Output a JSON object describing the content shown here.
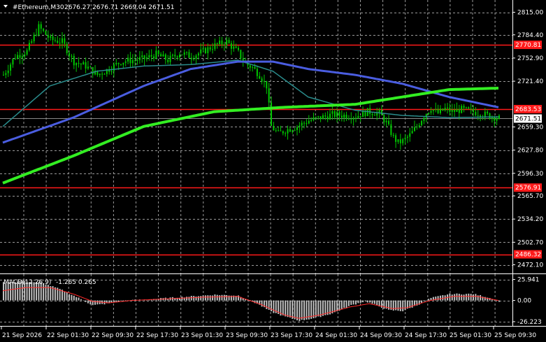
{
  "header": {
    "symbol_label": "#Ethereum,M30",
    "ohlc": "2676.27 2676.71 2669.04 2671.51"
  },
  "indicator_header": {
    "label": "MACD(12,26,9)",
    "values": "-1.265 0.265"
  },
  "colors": {
    "background": "#000000",
    "grid": "#9a9a9a",
    "candle": "#00c800",
    "ma_fast": "#2a8c8c",
    "ma_mid": "#4a5de0",
    "ma_slow": "#33ee22",
    "level_line": "#ff1a1a",
    "histogram": "#c0c0c0",
    "signal": "#ff2a2a"
  },
  "chart_data": [
    {
      "type": "candlestick",
      "title": "#Ethereum,M30",
      "price_ticks": [
        "2815.00",
        "2784.40",
        "2752.90",
        "2721.40",
        "2659.30",
        "2627.80",
        "2596.30",
        "2565.70",
        "2534.20",
        "2502.70",
        "2472.10"
      ],
      "ylim": [
        2466.0,
        2826.0
      ],
      "x_tick_labels": [
        "21 Sep 2026",
        "22 Sep 01:30",
        "22 Sep 09:30",
        "22 Sep 17:30",
        "23 Sep 01:30",
        "23 Sep 09:30",
        "23 Sep 17:30",
        "24 Sep 01:30",
        "24 Sep 09:30",
        "24 Sep 17:30",
        "25 Sep 01:30",
        "25 Sep 09:30"
      ],
      "current_price": {
        "label": "2671.51",
        "value": 2671.51
      },
      "levels": [
        {
          "label": "2770.81",
          "value": 2770.81
        },
        {
          "label": "2683.53",
          "value": 2683.53
        },
        {
          "label": "2576.91",
          "value": 2576.91
        },
        {
          "label": "2486.32",
          "value": 2486.32
        }
      ],
      "price_anchors": [
        [
          0,
          2730
        ],
        [
          5,
          2755
        ],
        [
          10,
          2762
        ],
        [
          15,
          2795
        ],
        [
          20,
          2778
        ],
        [
          25,
          2775
        ],
        [
          30,
          2748
        ],
        [
          35,
          2742
        ],
        [
          40,
          2730
        ],
        [
          45,
          2738
        ],
        [
          50,
          2748
        ],
        [
          55,
          2750
        ],
        [
          60,
          2752
        ],
        [
          65,
          2758
        ],
        [
          70,
          2750
        ],
        [
          75,
          2760
        ],
        [
          80,
          2755
        ],
        [
          85,
          2762
        ],
        [
          90,
          2770
        ],
        [
          95,
          2775
        ],
        [
          100,
          2760
        ],
        [
          103,
          2745
        ],
        [
          106,
          2740
        ],
        [
          109,
          2730
        ],
        [
          112,
          2715
        ],
        [
          114,
          2660
        ],
        [
          117,
          2650
        ],
        [
          120,
          2655
        ],
        [
          125,
          2660
        ],
        [
          130,
          2668
        ],
        [
          135,
          2672
        ],
        [
          140,
          2676
        ],
        [
          145,
          2675
        ],
        [
          150,
          2674
        ],
        [
          155,
          2680
        ],
        [
          160,
          2678
        ],
        [
          163,
          2665
        ],
        [
          166,
          2645
        ],
        [
          168,
          2638
        ],
        [
          170,
          2640
        ],
        [
          173,
          2648
        ],
        [
          176,
          2660
        ],
        [
          179,
          2675
        ],
        [
          182,
          2685
        ],
        [
          185,
          2678
        ],
        [
          188,
          2684
        ],
        [
          191,
          2680
        ],
        [
          195,
          2683
        ],
        [
          200,
          2680
        ],
        [
          205,
          2676
        ],
        [
          211,
          2671
        ]
      ],
      "ma_fast": [
        [
          0,
          2660
        ],
        [
          20,
          2715
        ],
        [
          40,
          2735
        ],
        [
          60,
          2742
        ],
        [
          80,
          2744
        ],
        [
          100,
          2750
        ],
        [
          115,
          2735
        ],
        [
          130,
          2700
        ],
        [
          150,
          2682
        ],
        [
          170,
          2675
        ],
        [
          190,
          2672
        ],
        [
          211,
          2673
        ]
      ],
      "ma_mid": [
        [
          0,
          2638
        ],
        [
          30,
          2672
        ],
        [
          60,
          2715
        ],
        [
          80,
          2738
        ],
        [
          100,
          2748
        ],
        [
          115,
          2748
        ],
        [
          130,
          2738
        ],
        [
          150,
          2730
        ],
        [
          170,
          2718
        ],
        [
          190,
          2700
        ],
        [
          211,
          2686
        ]
      ],
      "ma_slow": [
        [
          0,
          2583
        ],
        [
          30,
          2620
        ],
        [
          60,
          2660
        ],
        [
          90,
          2680
        ],
        [
          120,
          2686
        ],
        [
          150,
          2690
        ],
        [
          170,
          2700
        ],
        [
          190,
          2710
        ],
        [
          211,
          2712
        ]
      ]
    },
    {
      "type": "bar",
      "title": "MACD(12,26,9)",
      "macd_ticks": [
        "25.941",
        "0.00",
        "-26.223"
      ],
      "ylim": [
        -28.0,
        29.0
      ],
      "histogram_anchors": [
        [
          0,
          22
        ],
        [
          8,
          24
        ],
        [
          16,
          22
        ],
        [
          24,
          14
        ],
        [
          32,
          3
        ],
        [
          38,
          -6
        ],
        [
          44,
          -4
        ],
        [
          52,
          0
        ],
        [
          60,
          1
        ],
        [
          70,
          3
        ],
        [
          80,
          5
        ],
        [
          90,
          7
        ],
        [
          100,
          6
        ],
        [
          108,
          -4
        ],
        [
          114,
          -14
        ],
        [
          120,
          -20
        ],
        [
          126,
          -25
        ],
        [
          132,
          -22
        ],
        [
          140,
          -16
        ],
        [
          148,
          -6
        ],
        [
          154,
          -1
        ],
        [
          158,
          -5
        ],
        [
          164,
          -12
        ],
        [
          170,
          -13
        ],
        [
          176,
          -6
        ],
        [
          182,
          3
        ],
        [
          190,
          8
        ],
        [
          200,
          8
        ],
        [
          206,
          4
        ],
        [
          211,
          -1
        ]
      ],
      "signal_anchors": [
        [
          0,
          12
        ],
        [
          10,
          16
        ],
        [
          20,
          16
        ],
        [
          30,
          8
        ],
        [
          38,
          -1
        ],
        [
          45,
          -3
        ],
        [
          55,
          0
        ],
        [
          70,
          2
        ],
        [
          85,
          4
        ],
        [
          100,
          5
        ],
        [
          110,
          -5
        ],
        [
          120,
          -18
        ],
        [
          126,
          -22
        ],
        [
          135,
          -18
        ],
        [
          148,
          -8
        ],
        [
          156,
          -4
        ],
        [
          166,
          -10
        ],
        [
          172,
          -9
        ],
        [
          182,
          0
        ],
        [
          192,
          5
        ],
        [
          202,
          5
        ],
        [
          211,
          0
        ]
      ]
    }
  ]
}
